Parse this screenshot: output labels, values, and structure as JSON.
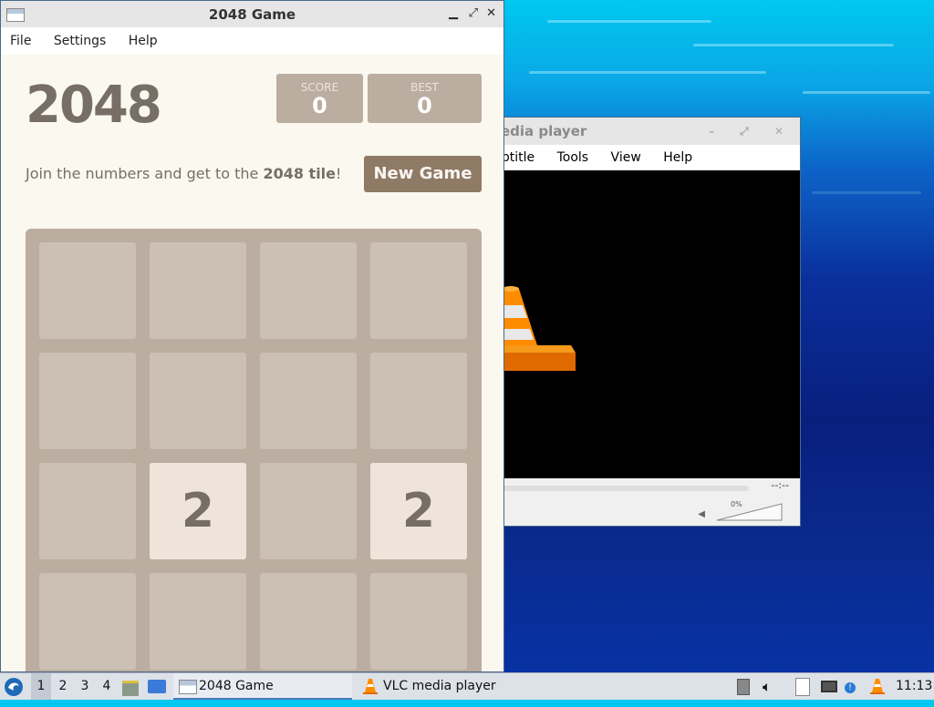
{
  "vlc": {
    "title": "VLC media player",
    "title_visible": "edia player",
    "menu": [
      "Subtitle",
      "Tools",
      "View",
      "Help"
    ],
    "menu_visible": [
      "ubtitle",
      "Tools",
      "View",
      "Help"
    ],
    "time": "--:--",
    "volume": "0%"
  },
  "game": {
    "window_title": "2048 Game",
    "menu": [
      "File",
      "Settings",
      "Help"
    ],
    "heading": "2048",
    "score_label": "SCORE",
    "score": "0",
    "best_label": "BEST",
    "best": "0",
    "intro_prefix": "Join the numbers and get to the ",
    "intro_bold": "2048 tile",
    "intro_suffix": "!",
    "new_game_label": "New Game",
    "grid": [
      [
        null,
        null,
        null,
        null
      ],
      [
        null,
        null,
        null,
        null
      ],
      [
        null,
        "2",
        null,
        "2"
      ],
      [
        null,
        null,
        null,
        null
      ]
    ]
  },
  "taskbar": {
    "workspaces": [
      "1",
      "2",
      "3",
      "4"
    ],
    "active_workspace": "1",
    "tasks": [
      {
        "label": "2048 Game",
        "icon": "window-icon",
        "active": true
      },
      {
        "label": "VLC media player",
        "icon": "vlc-cone-icon",
        "active": false
      }
    ],
    "clock": "11:13",
    "tray_icons": [
      "battery-icon",
      "volume-icon",
      "clipboard-icon",
      "network-icon",
      "notification-icon",
      "vlc-tray-icon"
    ]
  },
  "colors": {
    "tile_2": "#eee4da",
    "board": "#bbada0",
    "new_game": "#8f7a66",
    "text": "#776e65"
  }
}
